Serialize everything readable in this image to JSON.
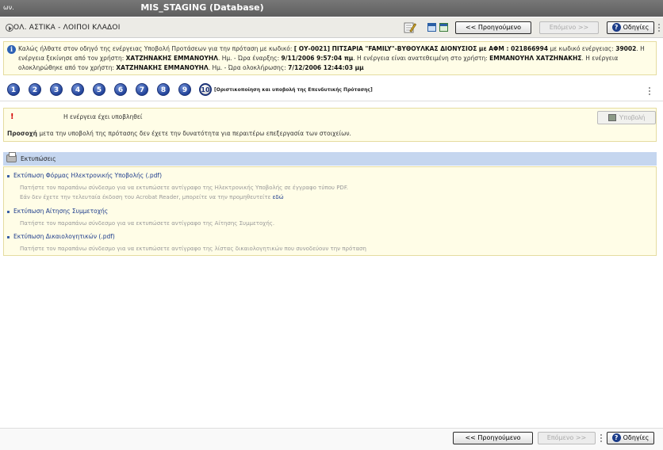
{
  "window": {
    "left_text": "ων.",
    "title": "MIS_STAGING (Database)"
  },
  "header": {
    "title": "ΟΛ. ΑΣΤΙΚΑ - ΛΟΙΠΟΙ ΚΛΑΔΟΙ"
  },
  "nav": {
    "prev_label": "<< Προηγούμενο",
    "next_label": "Επόμενο >>",
    "help_label": "Οδηγίες",
    "help_symbol": "?"
  },
  "info": {
    "t1": "Καλώς ήλθατε στον οδηγό της ενέργειας Υποβολή Προτάσεων για την πρόταση με κωδικό: ",
    "code": "[ ΟΥ-0021]  ΠΙΤΣΑΡΙΑ \"FAMILY\"-ΒΥΘΟΥΛΚΑΣ ΔΙΟΝΥΣΙΟΣ με ΑΦΜ : 021866994",
    "t2": " με κωδικό ενέργειας: ",
    "action_code": "39002",
    "t3": ". Η ενέργεια ξεκίνησε από τον χρήστη: ",
    "started_by": "ΧΑΤΖΗΝΑΚΗΣ ΕΜΜΑΝΟΥΗΛ",
    "t4": ". Ημ. - Ώρα έναρξης: ",
    "start_time": "9/11/2006 9:57:04 πμ",
    "t5": ". Η ενέργεια είναι ανατεθειμένη στο χρήστη: ",
    "assigned_to": "ΕΜΜΑΝΟΥΗΛ ΧΑΤΖΗΝΑΚΗΣ",
    "t6": ". Η ενέργεια ολοκληρώθηκε από τον χρήστη: ",
    "completed_by": "ΧΑΤΖΗΝΑΚΗΣ ΕΜΜΑΝΟΥΗΛ",
    "t7": ". Ημ. - Ώρα ολοκλήρωσης: ",
    "end_time": "7/12/2006 12:44:03 μμ"
  },
  "steps": {
    "items": [
      "1",
      "2",
      "3",
      "4",
      "5",
      "6",
      "7",
      "8",
      "9",
      "10"
    ],
    "current_label": "[Οριστικοποίηση και υποβολή της Επενδυτικής Πρότασης]"
  },
  "status": {
    "done_text": "Η ενέργεια έχει υποβληθεί",
    "submit_label": "Υποβολή",
    "note_bold": "Προσοχή",
    "note_text": " μετα την υποβολή της πρότασης δεν έχετε την δυνατότητα για περαιτέρω επεξεργασία των στοιχείων."
  },
  "prints": {
    "header": "Εκτυπώσεις",
    "item1_link": "Εκτύπωση Φόρμας Ηλεκτρονικής Υποβολής (.pdf)",
    "item1_desc1": "Πατήστε τον παραπάνω σύνδεσμο για να εκτυπώσετε αντίγραφο της Ηλεκτρονικής Υποβολής σε έγγραφο τύπου PDF.",
    "item1_desc2": "Εάν δεν έχετε την τελευταία έκδοση του Acrobat Reader, μπορείτε να την προμηθευτείτε ",
    "item1_here": "εδώ",
    "item2_link": "Εκτύπωση Αίτησης Συμμετοχής",
    "item2_desc": "Πατήστε τον παραπάνω σύνδεσμο για να εκτυπώσετε αντίγραφο της Αίτησης Συμμετοχής.",
    "item3_link": "Εκτύπωση Δικαιολογητικών (.pdf)",
    "item3_desc": "Πατήστε τον παραπάνω σύνδεσμο για να εκτυπώσετε αντίγραφο της λίστας δικαιολογητικών που συνοδεύουν την πρόταση"
  },
  "colors": {
    "accent": "#1c3b8c",
    "info_bg": "#fffde7",
    "section_header": "#c5d6ef"
  }
}
